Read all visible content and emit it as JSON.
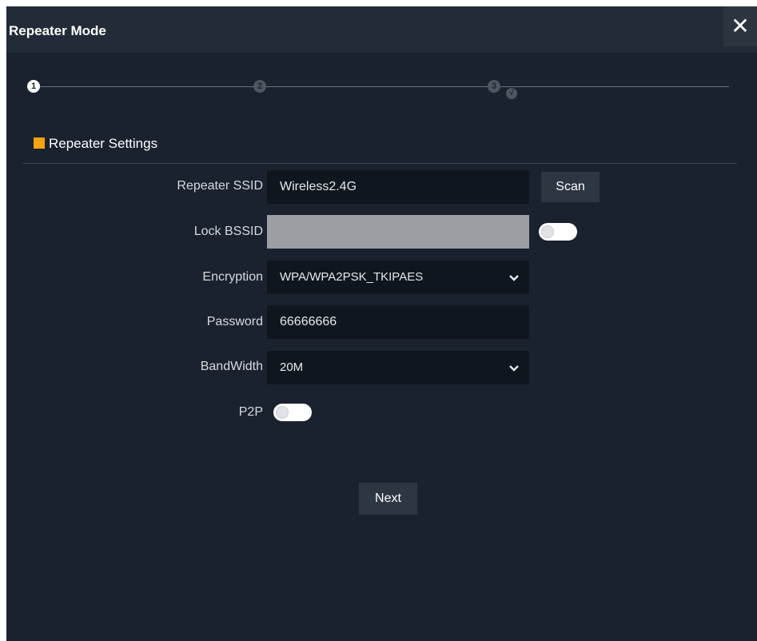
{
  "dialog": {
    "title": "Repeater Mode",
    "close_label": "✕"
  },
  "steps": [
    {
      "label": "❶",
      "active": true
    },
    {
      "label": "2",
      "active": false
    },
    {
      "label": "3",
      "active": false
    }
  ],
  "section": {
    "title": "Repeater Settings"
  },
  "form": {
    "ssid_label": "Repeater SSID",
    "ssid_value": "Wireless2.4G",
    "scan_label": "Scan",
    "lock_bssid_label": "Lock BSSID",
    "lock_bssid_enabled": false,
    "encryption_label": "Encryption",
    "encryption_value": "WPA/WPA2PSK_TKIPAES",
    "password_label": "Password",
    "password_value": "66666666",
    "bandwidth_label": "BandWidth",
    "bandwidth_value": "20M",
    "p2p_label": "P2P",
    "p2p_enabled": false
  },
  "actions": {
    "next_label": "Next"
  },
  "icons": {
    "dropdown": "chevron-down-icon"
  },
  "colors": {
    "accent": "#f5a30e",
    "background": "#19222e",
    "field": "#10161e"
  }
}
